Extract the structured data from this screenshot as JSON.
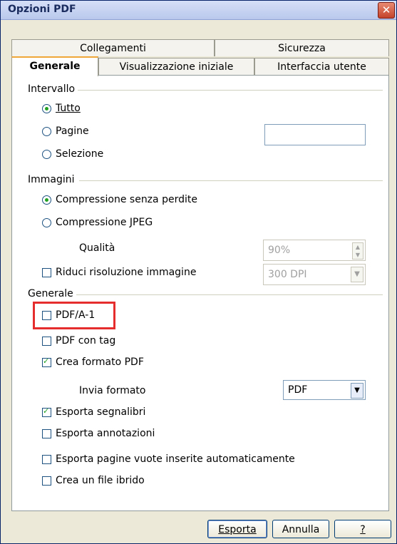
{
  "window": {
    "title": "Opzioni PDF"
  },
  "tabs": {
    "row1": [
      {
        "label": "Collegamenti"
      },
      {
        "label": "Sicurezza"
      }
    ],
    "row2": [
      {
        "label": "Generale"
      },
      {
        "label": "Visualizzazione iniziale"
      },
      {
        "label": "Interfaccia utente"
      }
    ]
  },
  "intervallo": {
    "label": "Intervallo",
    "tutto": "Tutto",
    "pagine": "Pagine",
    "selezione": "Selezione",
    "pagine_value": ""
  },
  "immagini": {
    "label": "Immagini",
    "senza_perdite": "Compressione senza perdite",
    "jpeg": "Compressione JPEG",
    "qualita_label": "Qualità",
    "qualita_value": "90%",
    "riduci": "Riduci risoluzione immagine",
    "dpi_value": "300 DPI"
  },
  "generale": {
    "label": "Generale",
    "pdfa": "PDF/A-1",
    "pdf_tag": "PDF con tag",
    "crea_formato": "Crea formato PDF",
    "invia_formato_label": "Invia formato",
    "invia_formato_value": "PDF",
    "segnalibri": "Esporta segnalibri",
    "annotazioni": "Esporta annotazioni",
    "pagine_vuote": "Esporta pagine vuote inserite automaticamente",
    "file_ibrido": "Crea un file ibrido"
  },
  "buttons": {
    "esporta": "Esporta",
    "annulla": "Annulla",
    "aiuto": "?"
  },
  "colors": {
    "highlight": "#e52d2d",
    "check": "#21a121"
  }
}
